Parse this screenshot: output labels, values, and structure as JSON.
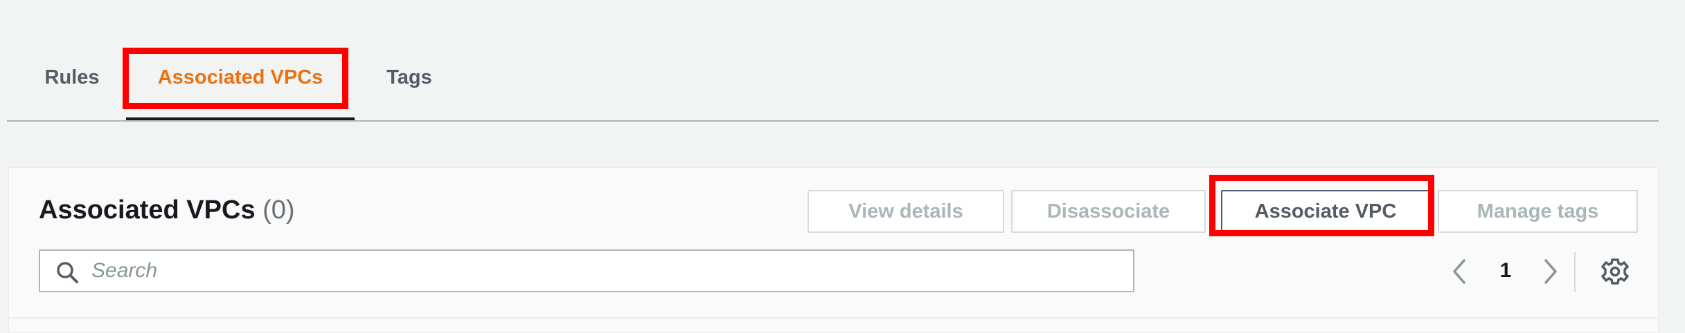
{
  "tabs": {
    "items": [
      {
        "label": "Rules"
      },
      {
        "label": "Associated VPCs"
      },
      {
        "label": "Tags"
      }
    ],
    "active": "Associated VPCs"
  },
  "panel": {
    "title": "Associated VPCs",
    "count": "(0)"
  },
  "actions": {
    "view_details": "View details",
    "disassociate": "Disassociate",
    "associate_vpc": "Associate VPC",
    "manage_tags": "Manage tags"
  },
  "search": {
    "placeholder": "Search",
    "value": ""
  },
  "pagination": {
    "current_page": "1"
  },
  "colors": {
    "active_tab": "#ec7211",
    "highlight": "#ff0000",
    "disabled_text": "#aab7b8",
    "background": "#f2f3f3"
  },
  "icons": {
    "search": "search-icon",
    "prev": "chevron-left-icon",
    "next": "chevron-right-icon",
    "settings": "gear-icon"
  }
}
